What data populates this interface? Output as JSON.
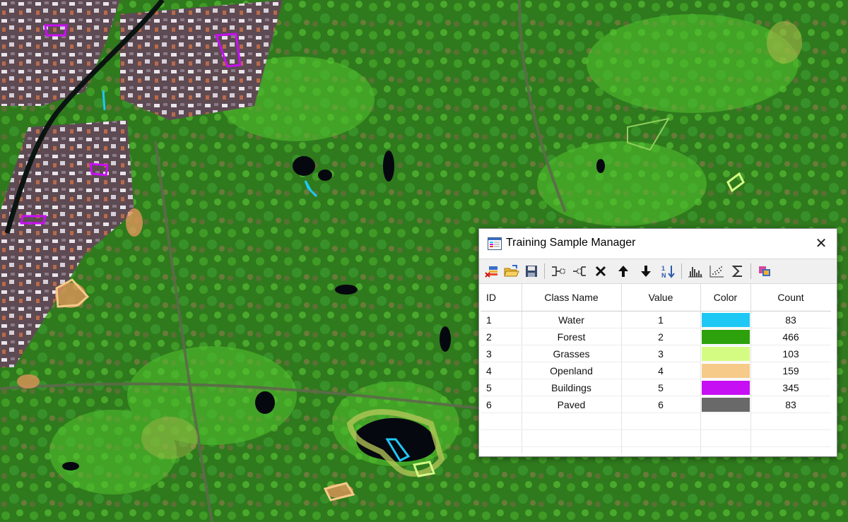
{
  "dialog": {
    "title": "Training Sample Manager",
    "close_symbol": "✕",
    "toolbar": [
      {
        "name": "delete-all-icon",
        "tooltip": ""
      },
      {
        "name": "open-folder-icon",
        "tooltip": ""
      },
      {
        "name": "save-icon",
        "tooltip": ""
      },
      {
        "name": "merge-icon",
        "tooltip": ""
      },
      {
        "name": "split-icon",
        "tooltip": ""
      },
      {
        "name": "delete-icon",
        "tooltip": ""
      },
      {
        "name": "move-up-icon",
        "tooltip": ""
      },
      {
        "name": "move-down-icon",
        "tooltip": ""
      },
      {
        "name": "sort-icon",
        "tooltip": ""
      },
      {
        "name": "histogram-icon",
        "tooltip": ""
      },
      {
        "name": "scatterplot-icon",
        "tooltip": ""
      },
      {
        "name": "statistics-icon",
        "tooltip": ""
      },
      {
        "name": "layer-icon",
        "tooltip": ""
      }
    ],
    "table": {
      "headers": [
        "ID",
        "Class Name",
        "Value",
        "Color",
        "Count"
      ],
      "rows": [
        {
          "id": "1",
          "name": "Water",
          "value": "1",
          "color": "#1ec8f5",
          "count": "83"
        },
        {
          "id": "2",
          "name": "Forest",
          "value": "2",
          "color": "#2ca10b",
          "count": "466"
        },
        {
          "id": "3",
          "name": "Grasses",
          "value": "3",
          "color": "#d4fc83",
          "count": "103"
        },
        {
          "id": "4",
          "name": "Openland",
          "value": "4",
          "color": "#f6ca88",
          "count": "159"
        },
        {
          "id": "5",
          "name": "Buildings",
          "value": "5",
          "color": "#c60ff3",
          "count": "345"
        },
        {
          "id": "6",
          "name": "Paved",
          "value": "6",
          "color": "#696969",
          "count": "83"
        }
      ],
      "empty_rows": 3
    }
  },
  "map": {
    "description_colors": {
      "vegetation": "#3a8a22",
      "bright_vegetation": "#4fb82c",
      "urban": "#8a6a7a",
      "water": "#0a0a14",
      "road": "#5d6a4a"
    },
    "sample_colors": {
      "water": "#1ec8f5",
      "grasses": "#d4fc83",
      "openland": "#f6ca88",
      "buildings": "#c60ff3"
    }
  }
}
